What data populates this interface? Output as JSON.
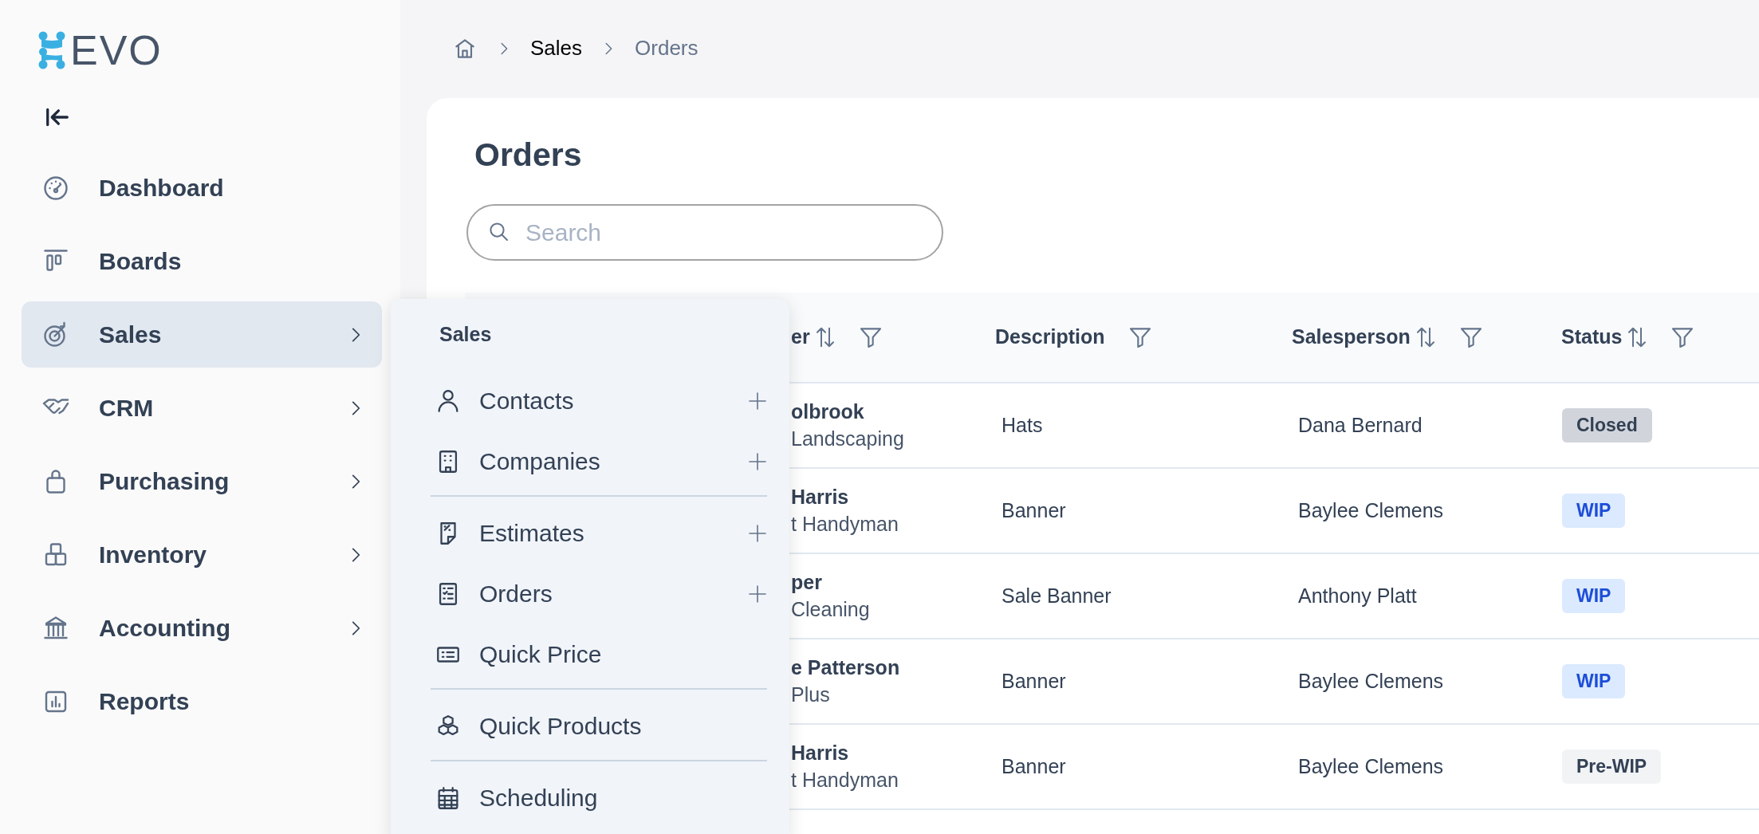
{
  "logo": {
    "text": "EVO"
  },
  "sidebar": {
    "items": [
      {
        "label": "Dashboard",
        "has_submenu": false,
        "selected": false
      },
      {
        "label": "Boards",
        "has_submenu": false,
        "selected": false
      },
      {
        "label": "Sales",
        "has_submenu": true,
        "selected": true
      },
      {
        "label": "CRM",
        "has_submenu": true,
        "selected": false
      },
      {
        "label": "Purchasing",
        "has_submenu": true,
        "selected": false
      },
      {
        "label": "Inventory",
        "has_submenu": true,
        "selected": false
      },
      {
        "label": "Accounting",
        "has_submenu": true,
        "selected": false
      },
      {
        "label": "Reports",
        "has_submenu": false,
        "selected": false
      }
    ]
  },
  "flyout": {
    "title": "Sales",
    "items": [
      {
        "label": "Contacts",
        "addable": true,
        "separator_before": false
      },
      {
        "label": "Companies",
        "addable": true,
        "separator_before": false
      },
      {
        "label": "Estimates",
        "addable": true,
        "separator_before": true
      },
      {
        "label": "Orders",
        "addable": true,
        "separator_before": false
      },
      {
        "label": "Quick Price",
        "addable": false,
        "separator_before": false
      },
      {
        "label": "Quick Products",
        "addable": false,
        "separator_before": true
      },
      {
        "label": "Scheduling",
        "addable": false,
        "separator_before": true
      }
    ]
  },
  "breadcrumb": [
    {
      "label": "Sales",
      "current": false
    },
    {
      "label": "Orders",
      "current": true
    }
  ],
  "page_title": "Orders",
  "search": {
    "placeholder": "Search"
  },
  "table": {
    "columns": [
      {
        "label": "er",
        "sortable": true,
        "filterable": true
      },
      {
        "label": "Description",
        "sortable": false,
        "filterable": true
      },
      {
        "label": "Salesperson",
        "sortable": true,
        "filterable": true
      },
      {
        "label": "Status",
        "sortable": true,
        "filterable": true
      }
    ],
    "rows": [
      {
        "column_1": "olbrook",
        "column_1_sub": "Landscaping",
        "description": "Hats",
        "salesperson": "Dana Bernard",
        "status": "Closed",
        "kind": "closed"
      },
      {
        "column_1": "Harris",
        "column_1_sub": "t Handyman",
        "description": "Banner",
        "salesperson": "Baylee Clemens",
        "status": "WIP",
        "kind": "wip"
      },
      {
        "column_1": "per",
        "column_1_sub": "Cleaning",
        "description": "Sale Banner",
        "salesperson": "Anthony Platt",
        "status": "WIP",
        "kind": "wip"
      },
      {
        "column_1": "e Patterson",
        "column_1_sub": "Plus",
        "description": "Banner",
        "salesperson": "Baylee Clemens",
        "status": "WIP",
        "kind": "wip"
      },
      {
        "column_1": "Harris",
        "column_1_sub": "t Handyman",
        "description": "Banner",
        "salesperson": "Baylee Clemens",
        "status": "Pre-WIP",
        "kind": "prewip"
      }
    ]
  }
}
